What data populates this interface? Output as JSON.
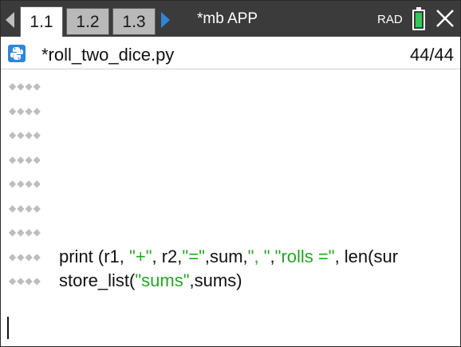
{
  "topbar": {
    "tabs": [
      {
        "label": "1.1",
        "active": true
      },
      {
        "label": "1.2",
        "active": false
      },
      {
        "label": "1.3",
        "active": false
      }
    ],
    "document_title": "*mb APP",
    "angle_mode": "RAD",
    "icons": [
      "nav-left-arrow",
      "nav-right-arrow",
      "battery-icon",
      "close-icon"
    ],
    "colors": {
      "bar": "#3b3b3b",
      "battery": "#34c759",
      "nav_arrow": "#2f86d6"
    }
  },
  "file": {
    "name": "*roll_two_dice.py",
    "line_position": "44/44",
    "icon": "python-icon"
  },
  "editor": {
    "indent_marker": "◆◆◆◆",
    "lines": [
      {
        "segments": []
      },
      {
        "segments": []
      },
      {
        "segments": []
      },
      {
        "segments": []
      },
      {
        "segments": []
      },
      {
        "segments": []
      },
      {
        "segments": []
      },
      {
        "segments": [
          {
            "text": "print (r1, ",
            "type": "code"
          },
          {
            "text": "\"+\"",
            "type": "string"
          },
          {
            "text": ", r2,",
            "type": "code"
          },
          {
            "text": "\"=\"",
            "type": "string"
          },
          {
            "text": ",sum,",
            "type": "code"
          },
          {
            "text": "\", \"",
            "type": "string"
          },
          {
            "text": ",",
            "type": "code"
          },
          {
            "text": "\"rolls =\"",
            "type": "string"
          },
          {
            "text": ", len(sur",
            "type": "code"
          }
        ]
      },
      {
        "segments": [
          {
            "text": "store_list(",
            "type": "code"
          },
          {
            "text": "\"sums\"",
            "type": "string"
          },
          {
            "text": ",sums)",
            "type": "code"
          }
        ]
      }
    ],
    "colors": {
      "string": "#27a327",
      "code": "#111111",
      "indent_marker": "#bdbdbd"
    }
  }
}
